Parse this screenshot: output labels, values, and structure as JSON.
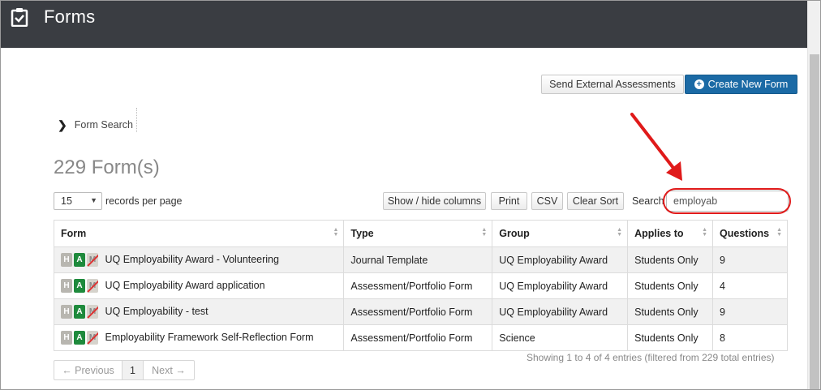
{
  "header": {
    "title": "Forms",
    "logo_icon": "clipboard-check-icon"
  },
  "actions": {
    "send_external": "Send External Assessments",
    "create_new": "Create New Form"
  },
  "breadcrumb": {
    "label": "Form Search"
  },
  "results": {
    "count_text": "229 Form(s)"
  },
  "records": {
    "value": "15",
    "label": "records per page"
  },
  "toolbar": {
    "show_hide": "Show / hide columns",
    "print": "Print",
    "csv": "CSV",
    "clear_sort": "Clear Sort"
  },
  "search": {
    "label": "Search",
    "value": "employab"
  },
  "table": {
    "columns": [
      "Form",
      "Type",
      "Group",
      "Applies to",
      "Questions"
    ],
    "rows": [
      [
        "UQ Employability Award - Volunteering",
        "Journal Template",
        "UQ Employability Award",
        "Students Only",
        "9"
      ],
      [
        "UQ Employability Award application",
        "Assessment/Portfolio Form",
        "UQ Employability Award",
        "Students Only",
        "4"
      ],
      [
        "UQ Employability - test",
        "Assessment/Portfolio Form",
        "UQ Employability Award",
        "Students Only",
        "9"
      ],
      [
        "Employability Framework Self-Reflection Form",
        "Assessment/Portfolio Form",
        "Science",
        "Students Only",
        "8"
      ]
    ],
    "badges": {
      "h": "H",
      "a": "A",
      "m": "M"
    }
  },
  "info": "Showing 1 to 4 of 4 entries (filtered from 229 total entries)",
  "pagination": {
    "previous": "← Previous",
    "current": "1",
    "next": "Next →"
  },
  "colors": {
    "header_bg": "#3a3d42",
    "primary": "#1b6aa5",
    "annotation": "#e01a1a",
    "approved_badge": "#1e8a3c"
  }
}
